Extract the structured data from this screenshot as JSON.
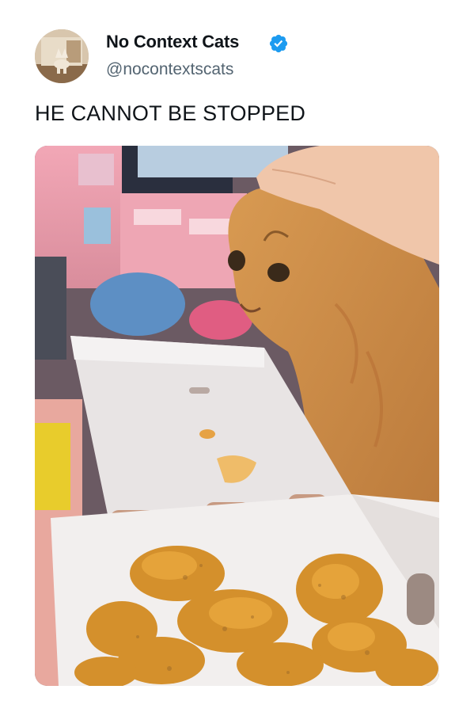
{
  "tweet": {
    "display_name": "No Context Cats",
    "handle": "@nocontextscats",
    "text": "HE CANNOT BE STOPPED",
    "verified_icon": "verified-badge-icon",
    "verified_color": "#1d9bf0"
  },
  "colors": {
    "name": "#0f1419",
    "handle": "#536471",
    "background": "#ffffff"
  }
}
